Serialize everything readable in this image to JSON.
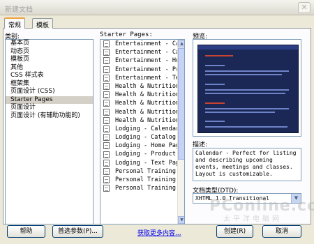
{
  "window": {
    "title": "新建文档",
    "close_glyph": "✕"
  },
  "tabs": [
    {
      "label": "常规",
      "active": true
    },
    {
      "label": "模板",
      "active": false
    }
  ],
  "category": {
    "label": "类别:",
    "items": [
      "基本页",
      "动态页",
      "模板页",
      "其他",
      "CSS 样式表",
      "框架集",
      "页面设计 (CSS)",
      "Starter Pages",
      "页面设计",
      "页面设计 (有辅助功能的)"
    ],
    "selected": "Starter Pages"
  },
  "starter_pages": {
    "label": "Starter Pages:",
    "items": [
      "Entertainment - Ca",
      "Entertainment - Ca",
      "Entertainment - Ho",
      "Entertainment - Pr",
      "Entertainment - Te",
      "Health & Nutrition",
      "Health & Nutrition",
      "Health & Nutrition",
      "Health & Nutrition",
      "Health & Nutrition",
      "Lodging - Calendar",
      "Lodging - Catalog",
      "Lodging - Home Pag",
      "Lodging - Product",
      "Lodging - Text Pag",
      "Personal Training",
      "Personal Training",
      "Personal Training"
    ]
  },
  "preview": {
    "label": "预览:"
  },
  "description": {
    "label": "描述:",
    "text": "Calendar - Perfect for listing and describing upcoming events, meetings and classes. Layout is customizable."
  },
  "dtd": {
    "label": "文档类型(DTD):",
    "value": "XHTML 1.0 Transitional"
  },
  "buttons": {
    "help": "帮助",
    "preferences": "首选参数(P)...",
    "more_content": "获取更多内容...",
    "create": "创建(R)",
    "cancel": "取消"
  },
  "watermark": {
    "text": "PConline.com.cn",
    "sub": "太平洋电脑网"
  },
  "colors": {
    "accent": "#f0a23c",
    "selection": "#d4d0c8",
    "border": "#7f9db9",
    "link": "#0000ee"
  }
}
